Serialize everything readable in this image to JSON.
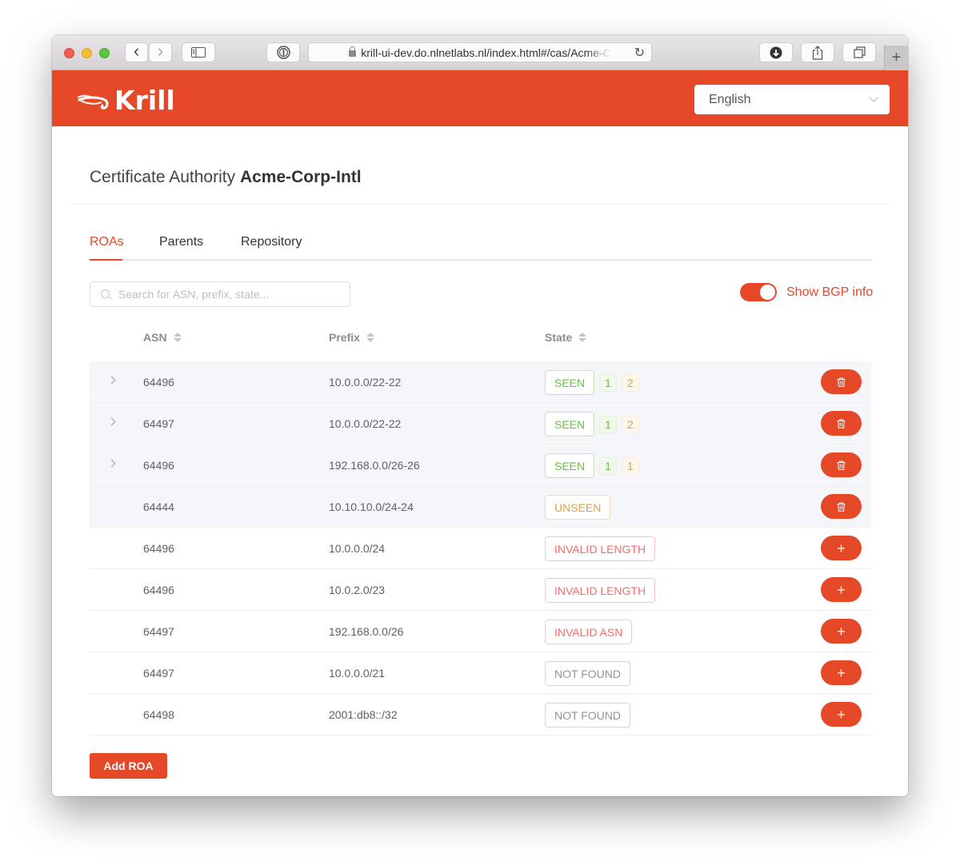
{
  "browser": {
    "url": "krill-ui-dev.do.nlnetlabs.nl/index.html#/cas/Acme-Corp-Intl",
    "url_display": "krill-ui-dev.do.nlnetlabs.nl/index.html#/cas/Acme-C",
    "icons": {
      "back": "‹",
      "forward": "›",
      "reload": "↻",
      "new_tab": "+"
    }
  },
  "header": {
    "logo_text": "Krill",
    "language": "English"
  },
  "page": {
    "title_prefix": "Certificate Authority",
    "ca_name": "Acme-Corp-Intl"
  },
  "tabs": [
    {
      "label": "ROAs",
      "active": true
    },
    {
      "label": "Parents",
      "active": false
    },
    {
      "label": "Repository",
      "active": false
    }
  ],
  "search": {
    "placeholder": "Search for ASN, prefix, state...",
    "value": ""
  },
  "bgp_toggle": {
    "label": "Show BGP info",
    "on": true
  },
  "table": {
    "columns": [
      "ASN",
      "Prefix",
      "State"
    ],
    "rows": [
      {
        "asn": "64496",
        "prefix": "10.0.0.0/22-22",
        "state": "SEEN",
        "state_type": "seen",
        "counts": [
          "1",
          "2"
        ],
        "expandable": true,
        "action": "delete"
      },
      {
        "asn": "64497",
        "prefix": "10.0.0.0/22-22",
        "state": "SEEN",
        "state_type": "seen",
        "counts": [
          "1",
          "2"
        ],
        "expandable": true,
        "action": "delete"
      },
      {
        "asn": "64496",
        "prefix": "192.168.0.0/26-26",
        "state": "SEEN",
        "state_type": "seen",
        "counts": [
          "1",
          "1"
        ],
        "expandable": true,
        "action": "delete"
      },
      {
        "asn": "64444",
        "prefix": "10.10.10.0/24-24",
        "state": "UNSEEN",
        "state_type": "unseen",
        "counts": [],
        "expandable": false,
        "action": "delete"
      },
      {
        "asn": "64496",
        "prefix": "10.0.0.0/24",
        "state": "INVALID LENGTH",
        "state_type": "invalid",
        "counts": [],
        "expandable": false,
        "action": "add"
      },
      {
        "asn": "64496",
        "prefix": "10.0.2.0/23",
        "state": "INVALID LENGTH",
        "state_type": "invalid",
        "counts": [],
        "expandable": false,
        "action": "add"
      },
      {
        "asn": "64497",
        "prefix": "192.168.0.0/26",
        "state": "INVALID ASN",
        "state_type": "invalid",
        "counts": [],
        "expandable": false,
        "action": "add"
      },
      {
        "asn": "64497",
        "prefix": "10.0.0.0/21",
        "state": "NOT FOUND",
        "state_type": "notfound",
        "counts": [],
        "expandable": false,
        "action": "add"
      },
      {
        "asn": "64498",
        "prefix": "2001:db8::/32",
        "state": "NOT FOUND",
        "state_type": "notfound",
        "counts": [],
        "expandable": false,
        "action": "add"
      }
    ]
  },
  "add_roa_label": "Add ROA",
  "colors": {
    "brand": "#e54826",
    "seen": "#67c23a",
    "unseen": "#e6a23c",
    "invalid": "#f56c6c",
    "notfound": "#909399"
  }
}
